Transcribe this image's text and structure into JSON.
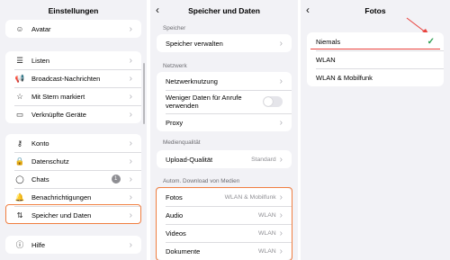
{
  "panel_settings": {
    "title": "Einstellungen",
    "avatar": "Avatar",
    "group2": [
      "Listen",
      "Broadcast-Nachrichten",
      "Mit Stern markiert",
      "Verknüpfte Geräte"
    ],
    "group3": [
      "Konto",
      "Datenschutz",
      "Chats",
      "Benachrichtigungen",
      "Speicher und Daten"
    ],
    "chats_badge": "1",
    "help": "Hilfe"
  },
  "panel_storage": {
    "title": "Speicher und Daten",
    "sec_storage": "Speicher",
    "manage_storage": "Speicher verwalten",
    "sec_network": "Netzwerk",
    "network_usage": "Netzwerknutzung",
    "less_data": "Weniger Daten für Anrufe verwenden",
    "proxy": "Proxy",
    "sec_media": "Medienqualität",
    "upload_quality": "Upload-Qualität",
    "upload_value": "Standard",
    "sec_auto": "Autom. Download von Medien",
    "auto_rows": [
      {
        "label": "Fotos",
        "value": "WLAN & Mobilfunk"
      },
      {
        "label": "Audio",
        "value": "WLAN"
      },
      {
        "label": "Videos",
        "value": "WLAN"
      },
      {
        "label": "Dokumente",
        "value": "WLAN"
      }
    ]
  },
  "panel_photos": {
    "title": "Fotos",
    "options": [
      "Niemals",
      "WLAN",
      "WLAN & Mobilfunk"
    ],
    "selected_index": 0
  },
  "colors": {
    "highlight": "#f07e40",
    "check": "#2fa055",
    "annotation": "#e9433e"
  }
}
